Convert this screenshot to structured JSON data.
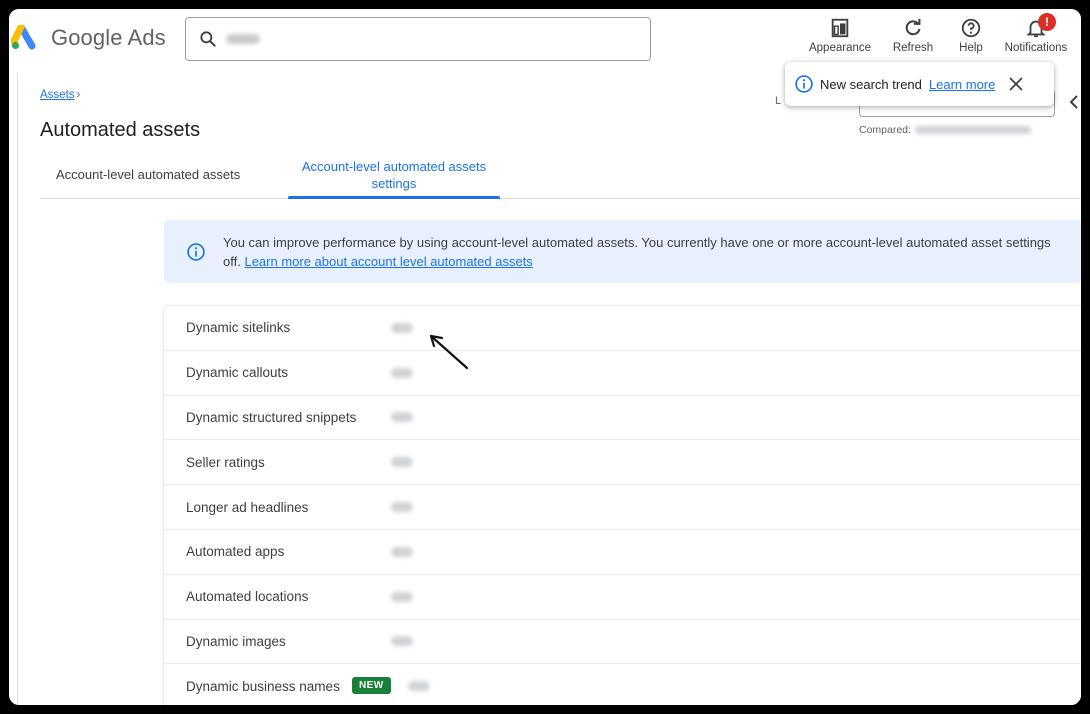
{
  "app": {
    "name": "Google Ads",
    "brand_colors": {
      "blue": "#4285F4",
      "yellow": "#FBBC04",
      "green": "#34A853"
    }
  },
  "search": {
    "icon": "search-icon"
  },
  "header_actions": [
    {
      "label": "Appearance",
      "icon": "appearance-icon"
    },
    {
      "label": "Refresh",
      "icon": "refresh-icon"
    },
    {
      "label": "Help",
      "icon": "help-icon"
    },
    {
      "label": "Notifications",
      "icon": "bell-icon",
      "badge": "!"
    }
  ],
  "toast": {
    "message": "New search trend",
    "link": "Learn more",
    "icon": "info-icon",
    "close_icon": "close-icon"
  },
  "date_range": {
    "compared_label": "Compared:"
  },
  "breadcrumb": {
    "label": "Assets",
    "separator": "›"
  },
  "page_title": "Automated assets",
  "tabs": [
    {
      "label": "Account-level automated assets",
      "active": false
    },
    {
      "label": "Account-level automated assets settings",
      "active": true
    }
  ],
  "banner": {
    "icon": "info-icon",
    "text_line1": "You can improve performance by using account-level automated assets. You currently have one or more account-level automated asset settings",
    "text_line2_prefix": "off.",
    "link": "Learn more about account level automated assets"
  },
  "assets": [
    {
      "name": "Dynamic sitelinks"
    },
    {
      "name": "Dynamic callouts"
    },
    {
      "name": "Dynamic structured snippets"
    },
    {
      "name": "Seller ratings"
    },
    {
      "name": "Longer ad headlines"
    },
    {
      "name": "Automated apps"
    },
    {
      "name": "Automated locations"
    },
    {
      "name": "Dynamic images"
    },
    {
      "name": "Dynamic business names",
      "badge": "NEW"
    }
  ],
  "colors": {
    "accent": "#1a73e8",
    "banner_bg": "#e8f0fe",
    "new_badge": "#188038",
    "notif_badge": "#d93025"
  }
}
